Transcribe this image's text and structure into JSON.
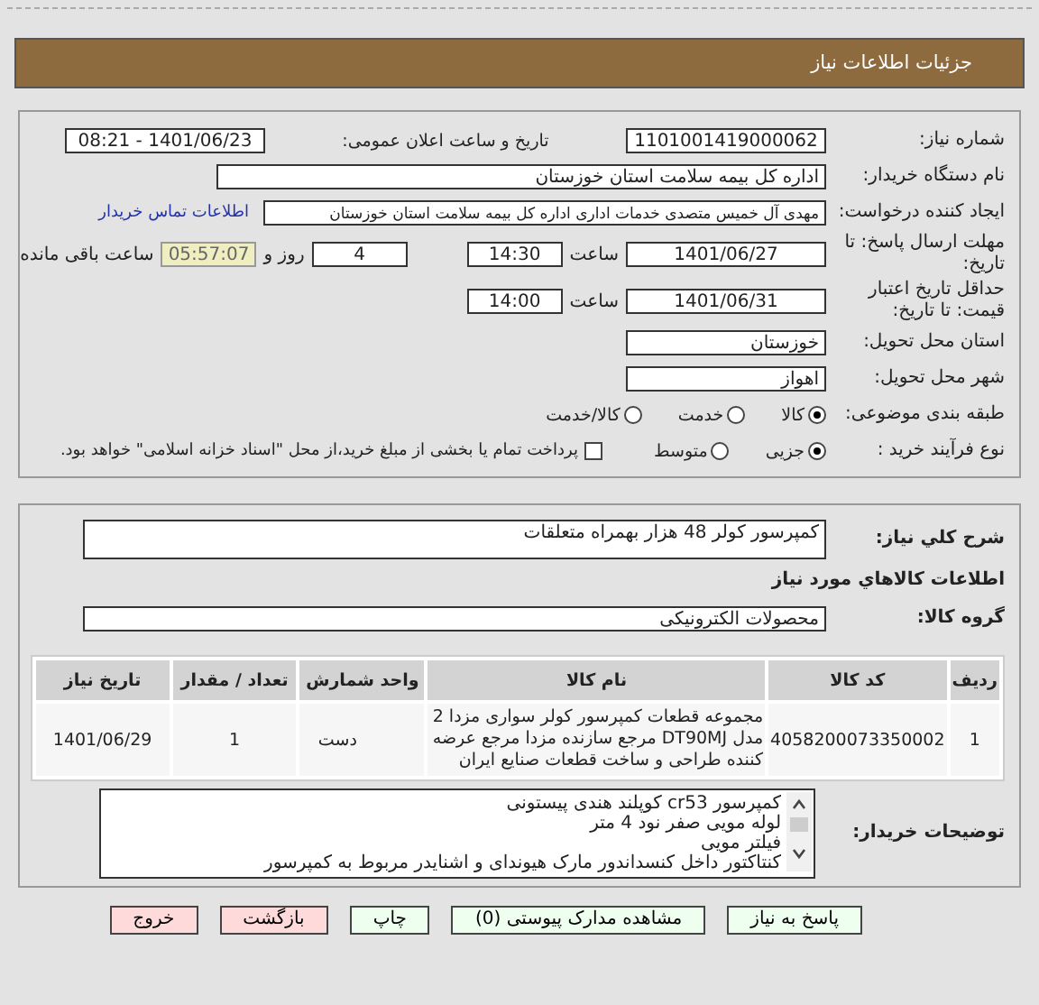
{
  "header": {
    "title": "جزئیات اطلاعات نیاز"
  },
  "need_number": {
    "label": "شماره نیاز:",
    "value": "1101001419000062"
  },
  "announce": {
    "label": "تاریخ و ساعت اعلان عمومی:",
    "value": "1401/06/23 - 08:21"
  },
  "buyer": {
    "label": "نام دستگاه خریدار:",
    "value": "اداره کل بیمه سلامت استان خوزستان"
  },
  "requester": {
    "label": "ایجاد کننده درخواست:",
    "value": "مهدی آل خمیس متصدی خدمات اداری اداره کل بیمه سلامت استان خوزستان",
    "link": "اطلاعات تماس خریدار"
  },
  "deadline": {
    "label": "مهلت ارسال پاسخ: تا تاریخ:",
    "date": "1401/06/27",
    "time_label": "ساعت",
    "time": "14:30",
    "days": "4",
    "days_label": "روز و",
    "remaining": "05:57:07",
    "remaining_label": "ساعت باقی مانده"
  },
  "validity": {
    "label": "حداقل تاریخ اعتبار قیمت: تا تاریخ:",
    "date": "1401/06/31",
    "time_label": "ساعت",
    "time": "14:00"
  },
  "province": {
    "label": "استان محل تحویل:",
    "value": "خوزستان"
  },
  "city": {
    "label": "شهر محل تحویل:",
    "value": "اهواز"
  },
  "category": {
    "label": "طبقه بندی موضوعی:",
    "options": [
      {
        "label": "کالا",
        "selected": true
      },
      {
        "label": "خدمت",
        "selected": false
      },
      {
        "label": "کالا/خدمت",
        "selected": false
      }
    ]
  },
  "process": {
    "label": "نوع فرآیند خرید :",
    "options": [
      {
        "label": "جزیی",
        "selected": true
      },
      {
        "label": "متوسط",
        "selected": false
      }
    ],
    "payment": {
      "checked": false,
      "label": "پرداخت تمام یا بخشی از مبلغ خرید،از محل \"اسناد خزانه اسلامی\" خواهد بود."
    }
  },
  "description": {
    "label": "شرح کلي نياز:",
    "value": "کمپرسور کولر 48 هزار بهمراه متعلقات"
  },
  "goods_title": "اطلاعات کالاهاي مورد نياز",
  "group": {
    "label": "گروه کالا:",
    "value": "محصولات الکترونیکی"
  },
  "table": {
    "columns": [
      "ردیف",
      "کد کالا",
      "نام کالا",
      "واحد شمارش",
      "تعداد / مقدار",
      "تاریخ نیاز"
    ],
    "rows": [
      [
        "1",
        "4058200073350002",
        "مجموعه قطعات کمپرسور کولر سواری مزدا 2 مدل DT90MJ مرجع سازنده مزدا مرجع عرضه کننده طراحی و ساخت قطعات صنایع ایران",
        "دست",
        "1",
        "1401/06/29"
      ]
    ]
  },
  "notes": {
    "label": "توضیحات خریدار:",
    "lines": [
      "کمپرسور cr53 کوپلند هندی پیستونی",
      "لوله مویی صفر نود 4 متر",
      "فیلتر مویی",
      "کنتاکتور داخل کنسداندور مارک هیوندای و اشنایدر مربوط به کمپرسور"
    ]
  },
  "buttons": [
    {
      "label": "پاسخ به نیاز",
      "kind": "action"
    },
    {
      "label": "مشاهده مدارک پیوستی (0)",
      "kind": "action"
    },
    {
      "label": "چاپ",
      "kind": "action"
    },
    {
      "label": "بازگشت",
      "kind": "exit"
    },
    {
      "label": "خروج",
      "kind": "exit"
    }
  ]
}
